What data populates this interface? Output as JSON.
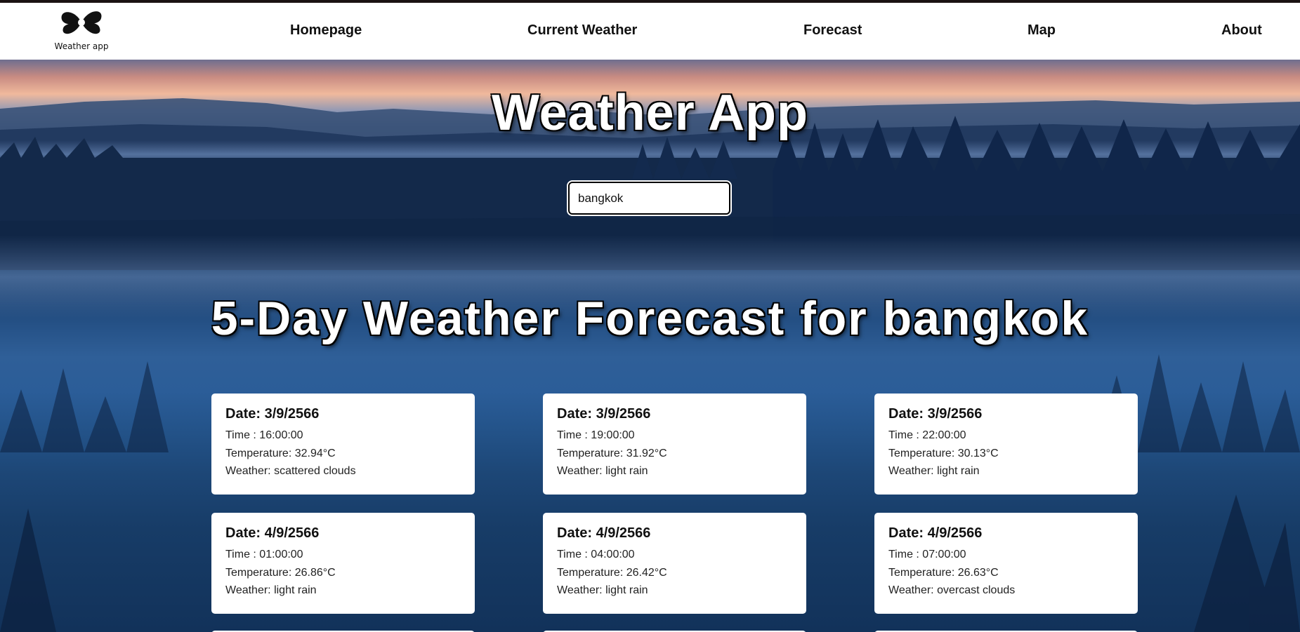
{
  "logo": {
    "text": "Weather app"
  },
  "nav": {
    "items": [
      {
        "label": "Homepage"
      },
      {
        "label": "Current Weather"
      },
      {
        "label": "Forecast"
      },
      {
        "label": "Map"
      },
      {
        "label": "About"
      }
    ]
  },
  "hero": {
    "title": "Weather App",
    "search": {
      "value": "bangkok"
    },
    "forecast_title": "5-Day Weather Forecast for bangkok"
  },
  "cards": [
    {
      "date": "Date: 3/9/2566",
      "time": "Time : 16:00:00",
      "temperature": "Temperature: 32.94°C",
      "weather": "Weather: scattered clouds"
    },
    {
      "date": "Date: 3/9/2566",
      "time": "Time : 19:00:00",
      "temperature": "Temperature: 31.92°C",
      "weather": "Weather: light rain"
    },
    {
      "date": "Date: 3/9/2566",
      "time": "Time : 22:00:00",
      "temperature": "Temperature: 30.13°C",
      "weather": "Weather: light rain"
    },
    {
      "date": "Date: 4/9/2566",
      "time": "Time : 01:00:00",
      "temperature": "Temperature: 26.86°C",
      "weather": "Weather: light rain"
    },
    {
      "date": "Date: 4/9/2566",
      "time": "Time : 04:00:00",
      "temperature": "Temperature: 26.42°C",
      "weather": "Weather: light rain"
    },
    {
      "date": "Date: 4/9/2566",
      "time": "Time : 07:00:00",
      "temperature": "Temperature: 26.63°C",
      "weather": "Weather: overcast clouds"
    }
  ],
  "colors": {
    "nav_bg": "#ffffff",
    "card_bg": "#ffffff",
    "title_text": "#ffffff",
    "title_outline": "#000000"
  }
}
